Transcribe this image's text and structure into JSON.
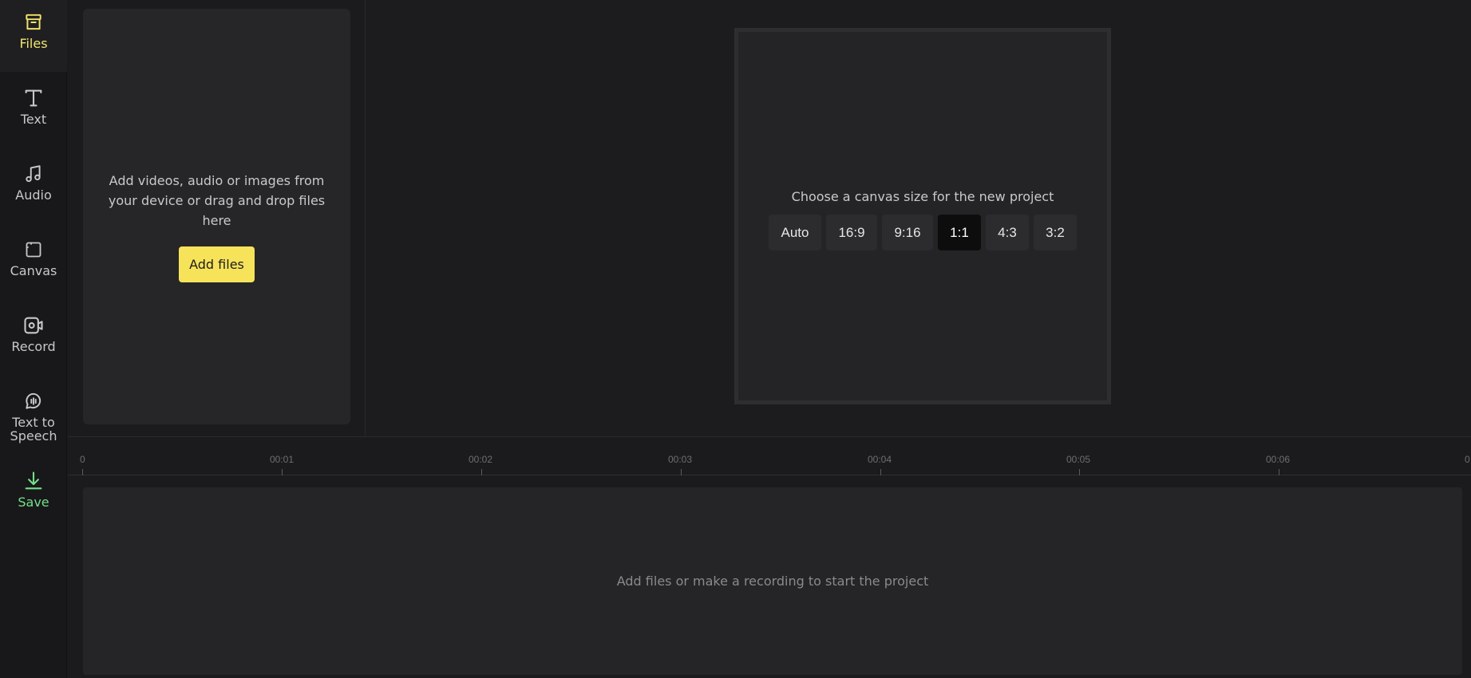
{
  "sidebar": {
    "items": [
      {
        "label": "Files",
        "icon": "archive-box-icon",
        "active": true
      },
      {
        "label": "Text",
        "icon": "text-t-icon"
      },
      {
        "label": "Audio",
        "icon": "music-note-icon"
      },
      {
        "label": "Canvas",
        "icon": "canvas-frame-icon"
      },
      {
        "label": "Record",
        "icon": "camera-record-icon"
      },
      {
        "label": "Text to Speech",
        "icon": "speech-bubble-icon"
      },
      {
        "label": "Save",
        "icon": "download-icon"
      }
    ]
  },
  "files_panel": {
    "hint": "Add videos, audio or images from your device or drag and drop files here",
    "add_button": "Add files"
  },
  "canvas": {
    "prompt": "Choose a canvas size for the new project",
    "ratios": [
      "Auto",
      "16:9",
      "9:16",
      "1:1",
      "4:3",
      "3:2"
    ],
    "selected": "1:1"
  },
  "timeline": {
    "ticks": [
      "0",
      "00:01",
      "00:02",
      "00:03",
      "00:04",
      "00:05",
      "00:06",
      "0"
    ],
    "empty_hint": "Add files or make a recording to start the project"
  },
  "colors": {
    "accent_yellow": "#f7e35a",
    "save_green": "#74e08a",
    "background": "#1b1b1d"
  }
}
